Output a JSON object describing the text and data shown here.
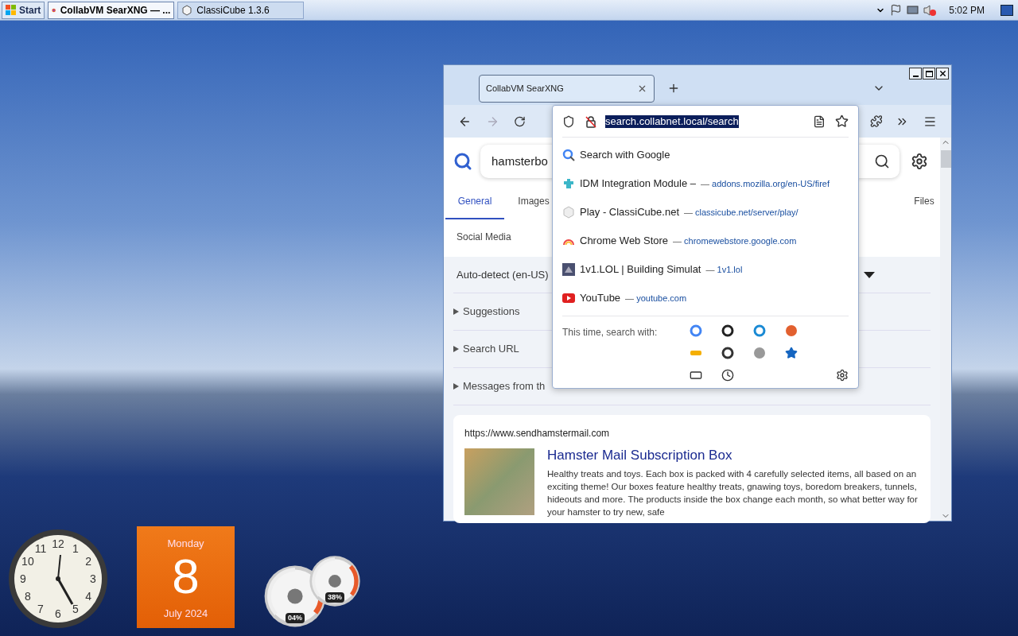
{
  "taskbar": {
    "start_label": "Start",
    "tasks": [
      {
        "label": "CollabVM SearXNG — ...",
        "selected": true
      },
      {
        "label": "ClassiCube 1.3.6",
        "selected": false
      }
    ],
    "time": "5:02 PM"
  },
  "browser": {
    "tabs": [
      {
        "title": "CollabVM SearXNG",
        "selected": true
      }
    ],
    "url": "search.collabnet.local/search"
  },
  "urlbar_dropdown": {
    "items": [
      {
        "kind": "search",
        "title": "Search with Google"
      },
      {
        "kind": "site",
        "title": "IDM Integration Module –",
        "url": "addons.mozilla.org/en-US/firef"
      },
      {
        "kind": "site",
        "title": "Play - ClassiCube.net",
        "url": "classicube.net/server/play/"
      },
      {
        "kind": "site",
        "title": "Chrome Web Store",
        "url": "chromewebstore.google.com"
      },
      {
        "kind": "site",
        "title": "1v1.LOL | Building Simulat",
        "url": "1v1.lol"
      },
      {
        "kind": "site",
        "title": "YouTube",
        "url": "youtube.com"
      }
    ],
    "separator": "—",
    "search_with_label": "This time, search with:"
  },
  "page": {
    "query": "hamsterbo",
    "categories": [
      {
        "label": "General",
        "selected": true
      },
      {
        "label": "Images",
        "selected": false
      },
      {
        "label": "Files",
        "selected": false
      },
      {
        "label": "Social Media",
        "selected": false
      }
    ],
    "language": "Auto-detect (en-US)",
    "sections": [
      {
        "label": "Suggestions",
        "expanded": false
      },
      {
        "label": "Search URL",
        "expanded": false
      },
      {
        "label": "Messages from th",
        "expanded": false
      }
    ],
    "result": {
      "url": "https://www.sendhamstermail.com",
      "title": "Hamster Mail Subscription Box",
      "snippet": "Healthy treats and toys. Each box is packed with 4 carefully selected items, all based on an exciting theme! Our boxes feature healthy treats, gnawing toys, boredom breakers, tunnels, hideouts and more. The products inside the box change each month, so what better way for your hamster to try new, safe"
    }
  },
  "gadgets": {
    "clock_numbers": [
      "12",
      "11",
      "1",
      "10",
      "2",
      "9",
      "3",
      "8",
      "4",
      "7",
      "5",
      "6"
    ],
    "calendar": {
      "weekday": "Monday",
      "day": "8",
      "month_year": "July 2024"
    },
    "meter": {
      "cpu": "04%",
      "memory": "38%"
    }
  }
}
